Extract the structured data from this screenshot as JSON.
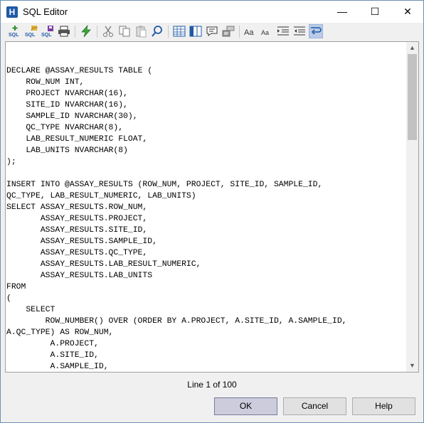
{
  "window": {
    "title": "SQL Editor",
    "minimize_icon": "—",
    "maximize_icon": "☐",
    "close_icon": "✕"
  },
  "editor": {
    "code": "DECLARE @ASSAY_RESULTS TABLE (\n    ROW_NUM INT,\n    PROJECT NVARCHAR(16),\n    SITE_ID NVARCHAR(16),\n    SAMPLE_ID NVARCHAR(30),\n    QC_TYPE NVARCHAR(8),\n    LAB_RESULT_NUMERIC FLOAT,\n    LAB_UNITS NVARCHAR(8)\n);\n\nINSERT INTO @ASSAY_RESULTS (ROW_NUM, PROJECT, SITE_ID, SAMPLE_ID,\nQC_TYPE, LAB_RESULT_NUMERIC, LAB_UNITS)\nSELECT ASSAY_RESULTS.ROW_NUM,\n       ASSAY_RESULTS.PROJECT,\n       ASSAY_RESULTS.SITE_ID,\n       ASSAY_RESULTS.SAMPLE_ID,\n       ASSAY_RESULTS.QC_TYPE,\n       ASSAY_RESULTS.LAB_RESULT_NUMERIC,\n       ASSAY_RESULTS.LAB_UNITS\nFROM\n(\n    SELECT\n        ROW_NUMBER() OVER (ORDER BY A.PROJECT, A.SITE_ID, A.SAMPLE_ID,\nA.QC_TYPE) AS ROW_NUM,\n         A.PROJECT,\n         A.SITE_ID,\n         A.SAMPLE_ID,"
  },
  "status": {
    "line_info": "Line 1 of 100"
  },
  "buttons": {
    "ok": "OK",
    "cancel": "Cancel",
    "help": "Help"
  }
}
